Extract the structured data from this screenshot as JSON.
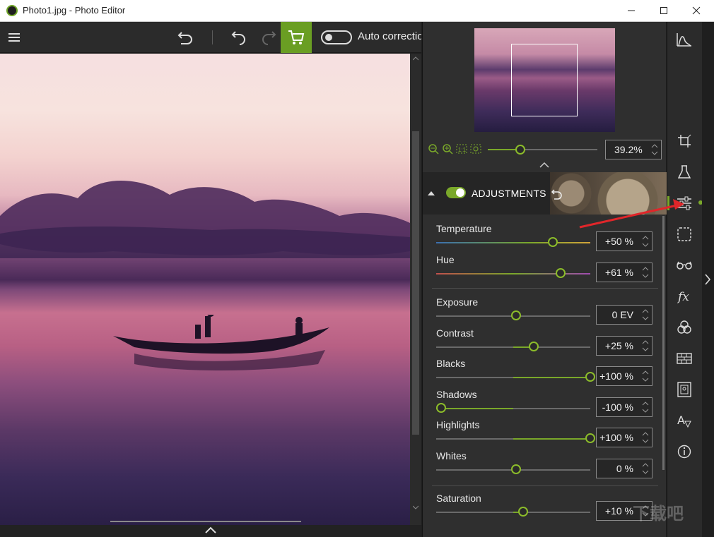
{
  "window": {
    "title": "Photo1.jpg - Photo Editor"
  },
  "toolbar": {
    "auto_correction_label": "Auto correctio"
  },
  "navigator": {
    "zoom_value": "39.2%"
  },
  "adjustments": {
    "title": "ADJUSTMENTS",
    "rows": [
      {
        "label": "Temperature",
        "value": "+50 %",
        "slider": 0.75
      },
      {
        "label": "Hue",
        "value": "+61 %",
        "slider": 0.8
      },
      {
        "label": "Exposure",
        "value": "0 EV",
        "slider": 0.5
      },
      {
        "label": "Contrast",
        "value": "+25 %",
        "slider": 0.62
      },
      {
        "label": "Blacks",
        "value": "+100 %",
        "slider": 1.0
      },
      {
        "label": "Shadows",
        "value": "-100 %",
        "slider": 0.0
      },
      {
        "label": "Highlights",
        "value": "+100 %",
        "slider": 1.0
      },
      {
        "label": "Whites",
        "value": "0 %",
        "slider": 0.5
      },
      {
        "label": "Saturation",
        "value": "+10 %",
        "slider": 0.55
      }
    ]
  },
  "colors": {
    "accent": "#7aa82a",
    "cart": "#6a9e23",
    "arrow": "#e0262a"
  },
  "watermark": "下载吧"
}
